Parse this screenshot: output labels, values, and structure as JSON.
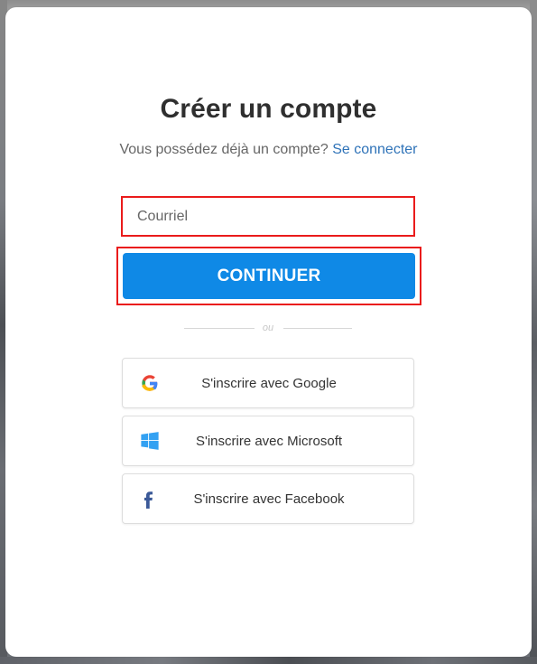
{
  "modal": {
    "title": "Créer un compte",
    "subtitle": {
      "prefix": "Vous possédez déjà un compte?",
      "link": "Se connecter"
    },
    "email": {
      "placeholder": "Courriel",
      "value": ""
    },
    "continue_label": "CONTINUER",
    "divider_text": "ou",
    "social": [
      {
        "label": "S'inscrire avec Google",
        "icon": "google-icon"
      },
      {
        "label": "S'inscrire avec Microsoft",
        "icon": "windows-icon"
      },
      {
        "label": "S'inscrire avec Facebook",
        "icon": "facebook-icon"
      }
    ]
  },
  "colors": {
    "primary": "#0f89e6",
    "link": "#2f73b8",
    "highlight": "#ea1b1b",
    "facebook": "#3b5998",
    "microsoft": "#33a1f2"
  }
}
